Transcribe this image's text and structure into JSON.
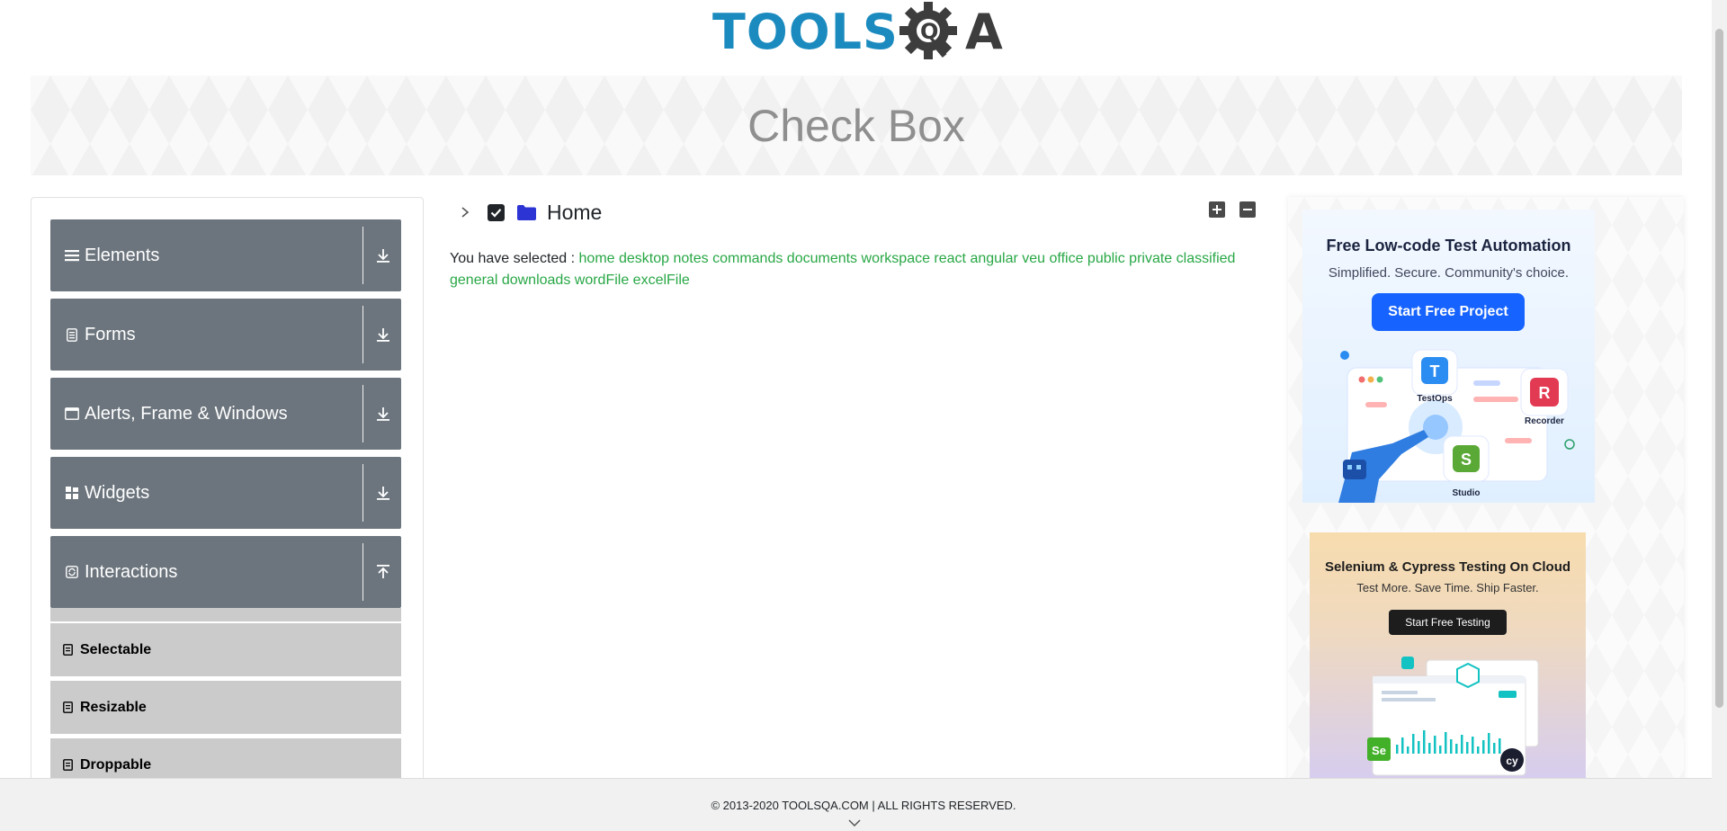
{
  "header": {
    "logo_tools": "TOOLS",
    "logo_q": "Q",
    "logo_a": "A"
  },
  "banner": {
    "title": "Check Box"
  },
  "sidebar": {
    "groups": [
      {
        "label": "Elements",
        "icon": "menu-icon",
        "expanded": false
      },
      {
        "label": "Forms",
        "icon": "document-icon",
        "expanded": false
      },
      {
        "label": "Alerts, Frame & Windows",
        "icon": "window-icon",
        "expanded": false
      },
      {
        "label": "Widgets",
        "icon": "grid-icon",
        "expanded": false
      },
      {
        "label": "Interactions",
        "icon": "refresh-icon",
        "expanded": true
      }
    ],
    "interactions_items": [
      {
        "label": "Selectable"
      },
      {
        "label": "Resizable"
      },
      {
        "label": "Droppable"
      }
    ]
  },
  "tree": {
    "root_label": "Home",
    "checked": true,
    "expanded": false
  },
  "result": {
    "prefix": "You have selected :",
    "items": [
      "home",
      "desktop",
      "notes",
      "commands",
      "documents",
      "workspace",
      "react",
      "angular",
      "veu",
      "office",
      "public",
      "private",
      "classified",
      "general",
      "downloads",
      "wordFile",
      "excelFile"
    ]
  },
  "ads": {
    "ad1": {
      "title": "Free Low-code Test Automation",
      "subtitle": "Simplified. Secure. Community's choice.",
      "button": "Start Free Project",
      "tiles": [
        "TestOps",
        "Recorder",
        "Studio"
      ]
    },
    "ad2": {
      "title": "Selenium & Cypress Testing On Cloud",
      "subtitle": "Test More. Save Time. Ship Faster.",
      "button": "Start Free Testing",
      "badges": [
        "Se",
        "cy"
      ]
    }
  },
  "footer": {
    "text": "© 2013-2020 TOOLSQA.COM | ALL RIGHTS RESERVED."
  },
  "colors": {
    "accent_blue": "#1b8bbf",
    "sidebar_header": "#6c757d",
    "sidebar_subitem": "#cbcbcb",
    "selected_text": "#28a745"
  }
}
